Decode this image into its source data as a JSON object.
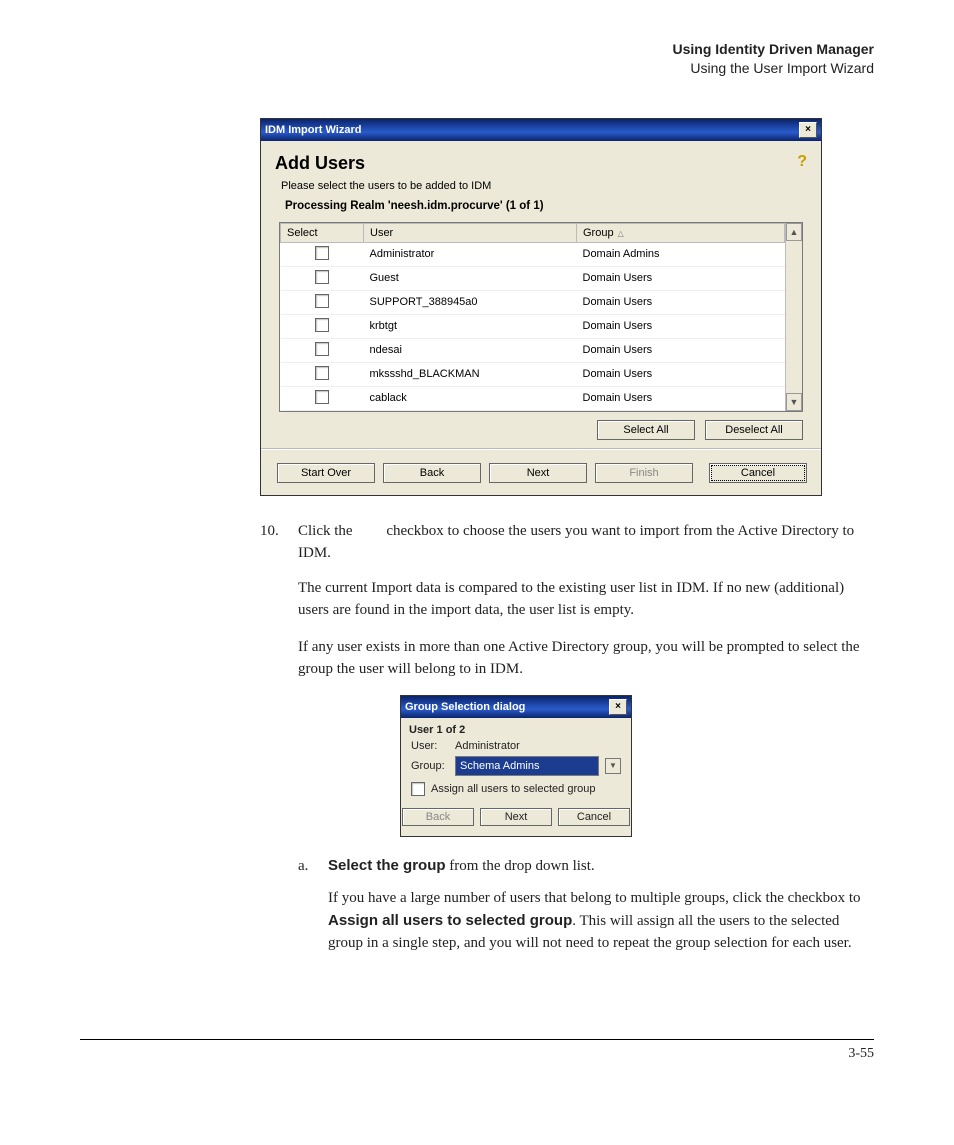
{
  "header": {
    "title": "Using Identity Driven Manager",
    "subtitle": "Using the User Import Wizard"
  },
  "wizard1": {
    "window_title": "IDM Import Wizard",
    "heading": "Add Users",
    "instruction": "Please select the users to be added to IDM",
    "realm": "Processing Realm 'neesh.idm.procurve' (1 of 1)",
    "col_select": "Select",
    "col_user": "User",
    "col_group": "Group",
    "rows": [
      {
        "user": "Administrator",
        "group": "Domain Admins"
      },
      {
        "user": "Guest",
        "group": "Domain Users"
      },
      {
        "user": "SUPPORT_388945a0",
        "group": "Domain Users"
      },
      {
        "user": "krbtgt",
        "group": "Domain Users"
      },
      {
        "user": "ndesai",
        "group": "Domain Users"
      },
      {
        "user": "mkssshd_BLACKMAN",
        "group": "Domain Users"
      },
      {
        "user": "cablack",
        "group": "Domain Users"
      }
    ],
    "select_all": "Select All",
    "deselect_all": "Deselect All",
    "start_over": "Start Over",
    "back": "Back",
    "next": "Next",
    "finish": "Finish",
    "cancel": "Cancel"
  },
  "wizard2": {
    "window_title": "Group Selection dialog",
    "user_count": "User 1 of 2",
    "user_label": "User:",
    "user_value": "Administrator",
    "group_label": "Group:",
    "group_value": "Schema Admins",
    "assign_label": "Assign all users to selected group",
    "back": "Back",
    "next": "Next",
    "cancel": "Cancel"
  },
  "text": {
    "step_num": "10.",
    "step10_a": "Click the ",
    "step10_b": " checkbox to choose the users you want to import from the Active Directory to IDM.",
    "para2": "The current Import data is compared to the existing user list in IDM. If no new (additional) users are found in the import data, the user list is empty.",
    "para3": "If any user exists in more than one Active Directory group, you will be prompted to select the group the user will belong to in IDM.",
    "a_num": "a.",
    "a_bold": "Select the group",
    "a_rest": " from the drop down list.",
    "a_para_a": "If you have a large number of users that belong to multiple groups, click the checkbox to ",
    "a_bold2": "Assign all users to selected group",
    "a_para_b": ". This will assign all the users to the selected group in a single step, and you will not need to repeat the group selection for each user."
  },
  "footer": {
    "page": "3-55"
  }
}
